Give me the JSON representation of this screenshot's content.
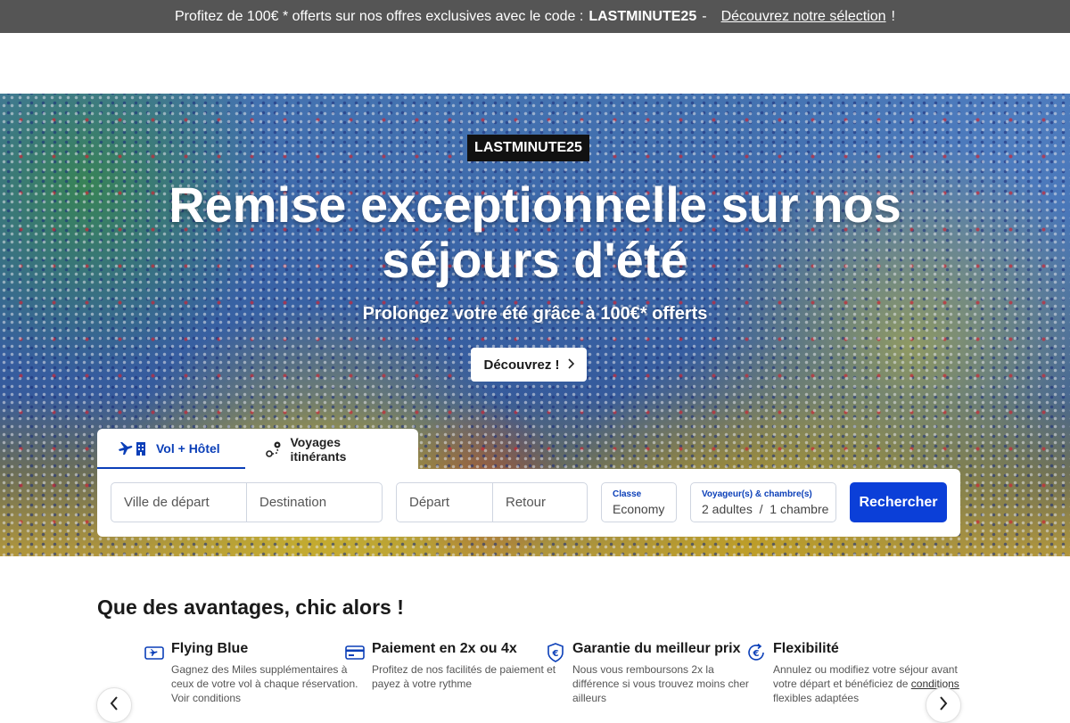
{
  "promo": {
    "text_before": "Profitez de 100€ * offerts sur nos offres exclusives avec le code :",
    "code": "LASTMINUTE25",
    "dash": "-",
    "link": "Découvrez notre sélection",
    "text_after": "!"
  },
  "hero": {
    "tag": "LASTMINUTE25",
    "title_line1": "Remise exceptionnelle sur nos",
    "title_line2": "séjours d'été",
    "subtitle": "Prolongez votre été grâce à 100€* offerts",
    "cta": "Découvrez !",
    "cta_icon": "chevron-right-icon"
  },
  "search": {
    "tabs": [
      {
        "label": "Vol + Hôtel",
        "icon": "plane-hotel-icon",
        "active": true
      },
      {
        "label": "Voyages itinérants",
        "icon": "route-icon",
        "active": false
      }
    ],
    "departure_city_placeholder": "Ville de départ",
    "destination_placeholder": "Destination",
    "depart_placeholder": "Départ",
    "return_placeholder": "Retour",
    "class_label": "Classe",
    "class_value": "Economy",
    "travellers_label": "Voyageur(s) & chambre(s)",
    "travellers_value": "2 adultes  /  1 chambre",
    "submit": "Rechercher"
  },
  "advantages": {
    "title": "Que des avantages, chic alors !",
    "items": [
      {
        "icon": "miles-card-icon",
        "title": "Flying Blue",
        "text": "Gagnez des Miles supplémentaires à ceux de votre vol à chaque réservation. Voir conditions"
      },
      {
        "icon": "credit-card-icon",
        "title": "Paiement en 2x ou 4x",
        "text": "Profitez de nos facilités de paiement et payez à votre rythme"
      },
      {
        "icon": "euro-shield-icon",
        "title": "Garantie du meilleur prix",
        "text": "Nous vous remboursons 2x la différence si vous trouvez moins cher ailleurs"
      },
      {
        "icon": "euro-refresh-icon",
        "title": "Flexibilité",
        "text_before": "Annulez ou modifiez votre séjour avant votre départ et bénéficiez de ",
        "text_link": "conditions",
        "text_after": " flexibles adaptées"
      }
    ],
    "prev_icon": "chevron-left-icon",
    "next_icon": "chevron-right-icon"
  },
  "colors": {
    "promo_bg": "#555555",
    "brand_blue": "#0b3fd8",
    "link_blue": "#0b3fb8"
  }
}
